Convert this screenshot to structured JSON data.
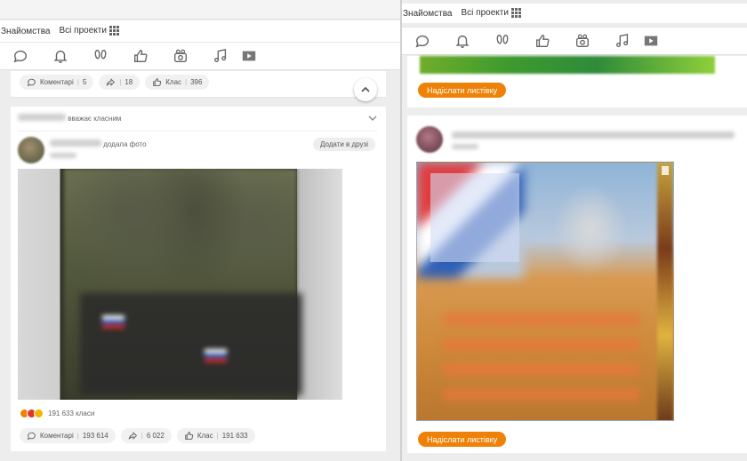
{
  "left": {
    "nav": {
      "item1": "Знайомства",
      "item2": "Всі проекти"
    },
    "post1": {
      "comments_label": "Коментарі",
      "comments_count": "5",
      "shares_count": "18",
      "likes_label": "Клас",
      "likes_count": "396"
    },
    "post2": {
      "header_action": "вважає класним",
      "author_action": "додала фото",
      "add_friend": "Додати в друзі",
      "reactions_text": "191 633 класи",
      "comments_label": "Коментарі",
      "comments_count": "193 614",
      "shares_count": "6 022",
      "likes_label": "Клас",
      "likes_count": "191 633"
    }
  },
  "right": {
    "nav": {
      "item1": "Знайомства",
      "item2": "Всі проекти"
    },
    "send_card_1": "Надіслати листівку",
    "send_card_2": "Надіслати листівку"
  },
  "colors": {
    "accent": "#ee8208",
    "nav_bg": "#ffffff",
    "page_bg": "#ededed"
  },
  "icons": [
    "message-icon",
    "bell-icon",
    "guests-icon",
    "like-icon",
    "gift-camera-icon",
    "music-icon",
    "video-icon",
    "grid-icon",
    "chevron-up-icon",
    "chevron-down-icon",
    "share-icon"
  ]
}
